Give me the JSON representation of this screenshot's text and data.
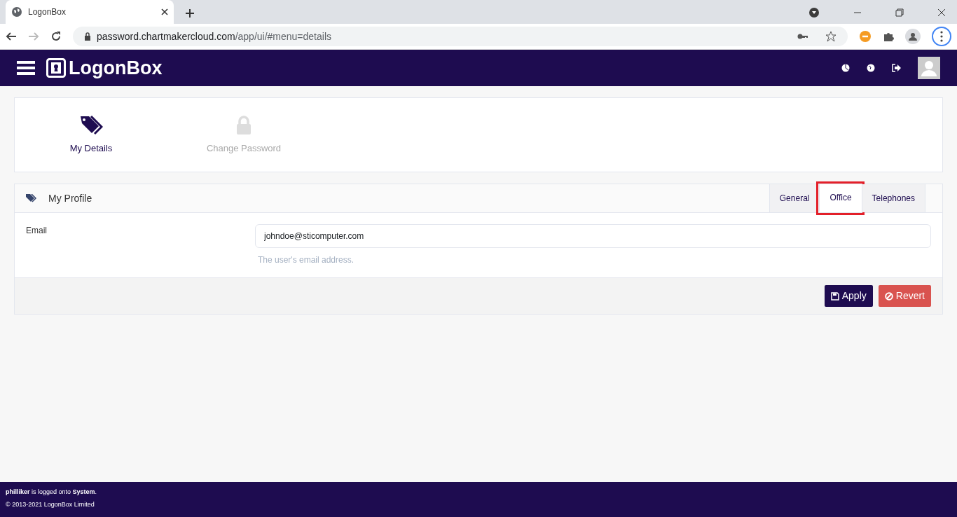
{
  "browser": {
    "tab_title": "LogonBox",
    "url_host": "password.chartmakercloud.com",
    "url_path": "/app/ui/#menu=details"
  },
  "app": {
    "logo": "LogonBox"
  },
  "menu": [
    {
      "label": "My Details",
      "selected": true,
      "kind": "tags"
    },
    {
      "label": "Change Password",
      "selected": false,
      "kind": "lock"
    }
  ],
  "panel": {
    "title": "My Profile",
    "tabs": [
      {
        "label": "General",
        "selected": false,
        "highlighted": false
      },
      {
        "label": "Office",
        "selected": true,
        "highlighted": true
      },
      {
        "label": "Telephones",
        "selected": false,
        "highlighted": false
      }
    ],
    "fields": [
      {
        "label": "Email",
        "value": "johndoe@sticomputer.com",
        "help": "The user's email address."
      }
    ],
    "buttons": [
      {
        "label": "Apply",
        "kind": "primary"
      },
      {
        "label": "Revert",
        "kind": "danger"
      }
    ]
  },
  "footer": {
    "login": "**philliker** is logged onto **System**.",
    "copyright": "© 2013-2021 LogonBox Limited"
  }
}
